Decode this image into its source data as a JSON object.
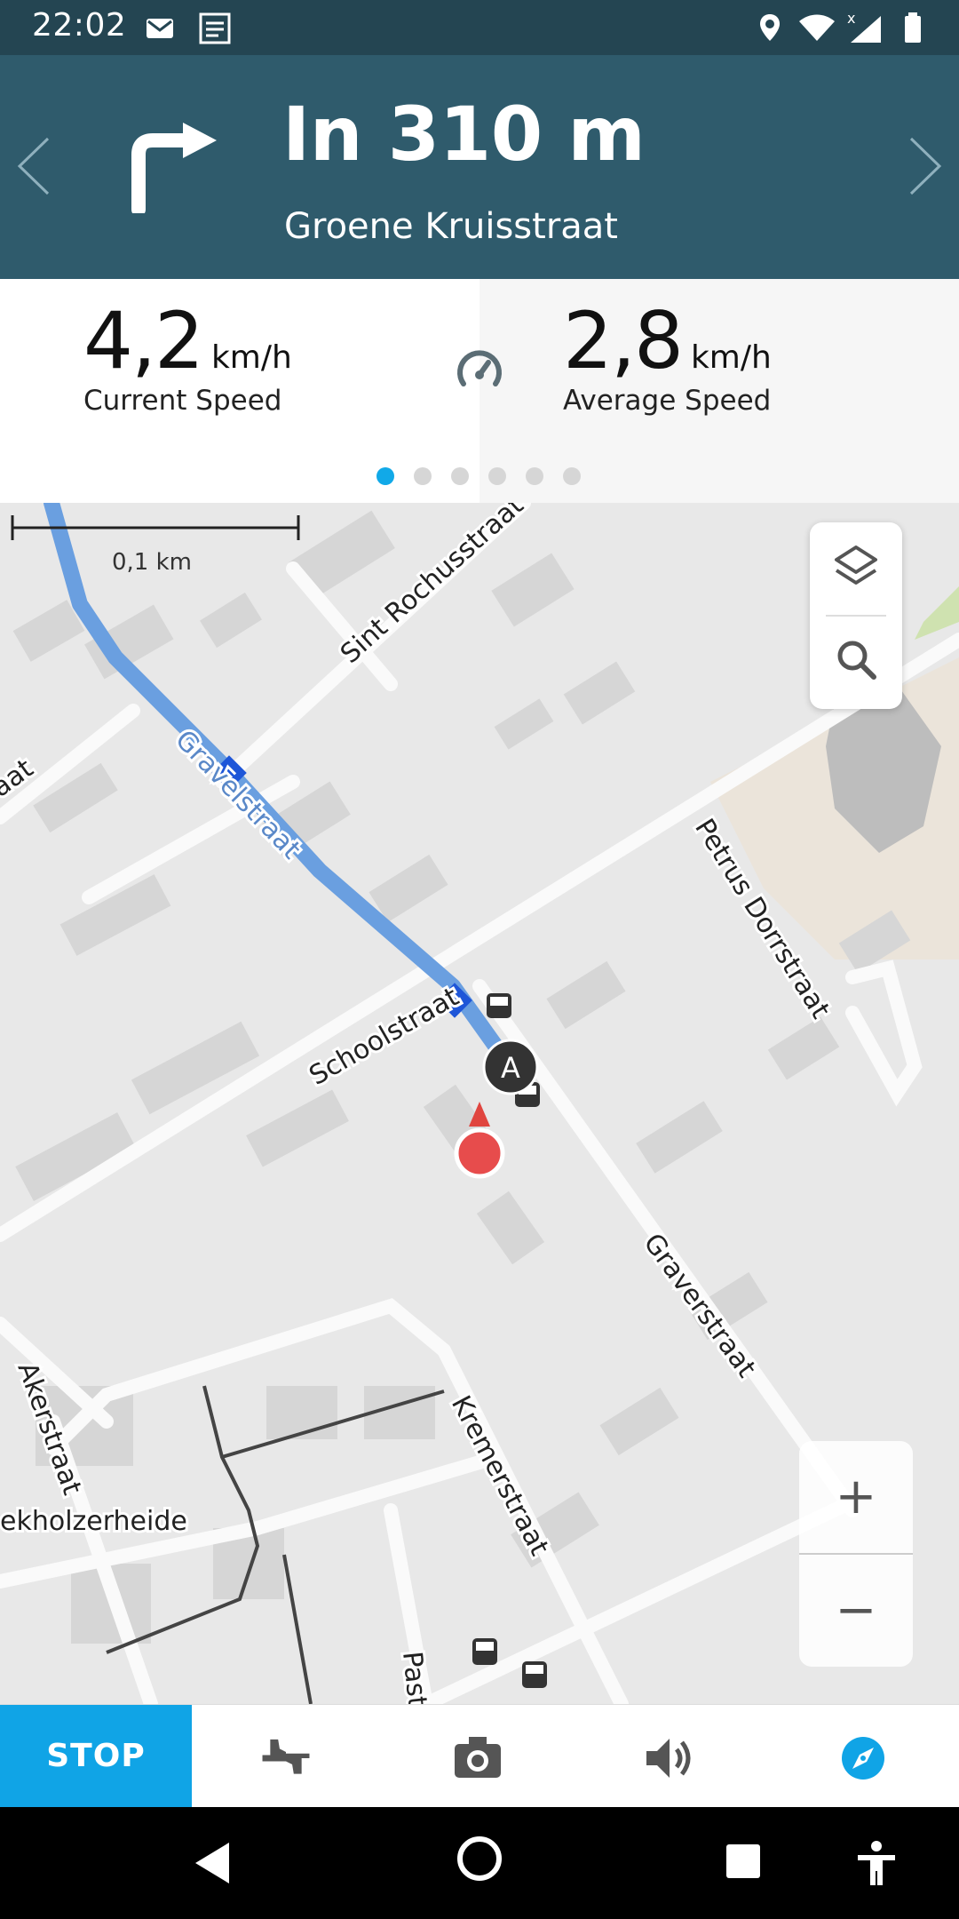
{
  "status_bar": {
    "time": "22:02",
    "icons": [
      "gmail-icon",
      "news-icon",
      "location-icon",
      "wifi-icon",
      "signal-icon",
      "battery-icon"
    ]
  },
  "navigation": {
    "distance": "In 310 m",
    "street": "Groene Kruisstraat",
    "turn_icon": "turn-right-icon"
  },
  "speed": {
    "current_value": "4,2",
    "current_unit": "km/h",
    "current_label": "Current Speed",
    "average_value": "2,8",
    "average_unit": "km/h",
    "average_label": "Average Speed",
    "page_count": 6,
    "active_page": 1
  },
  "map": {
    "scale_label": "0,1 km",
    "street_labels": [
      "Sint Rochusstraat",
      "Gravelstraat",
      "aat",
      "Petrus Dorrstraat",
      "Schoolstraat",
      "Graverstraat",
      "Akerstraat",
      "Kremerstraat",
      "ekholzerheide",
      "Past"
    ],
    "marker_label": "A"
  },
  "map_controls": {
    "layers_icon": "layers-icon",
    "search_icon": "search-icon",
    "zoom_in": "+",
    "zoom_out": "−"
  },
  "bottom_bar": {
    "stop_label": "STOP",
    "icons": [
      "thumbs-rating-icon",
      "camera-icon",
      "volume-icon",
      "compass-icon"
    ],
    "accent_color": "#10a4e6"
  },
  "system_nav": {
    "icons": [
      "back-icon",
      "home-icon",
      "recents-icon",
      "accessibility-icon"
    ]
  }
}
